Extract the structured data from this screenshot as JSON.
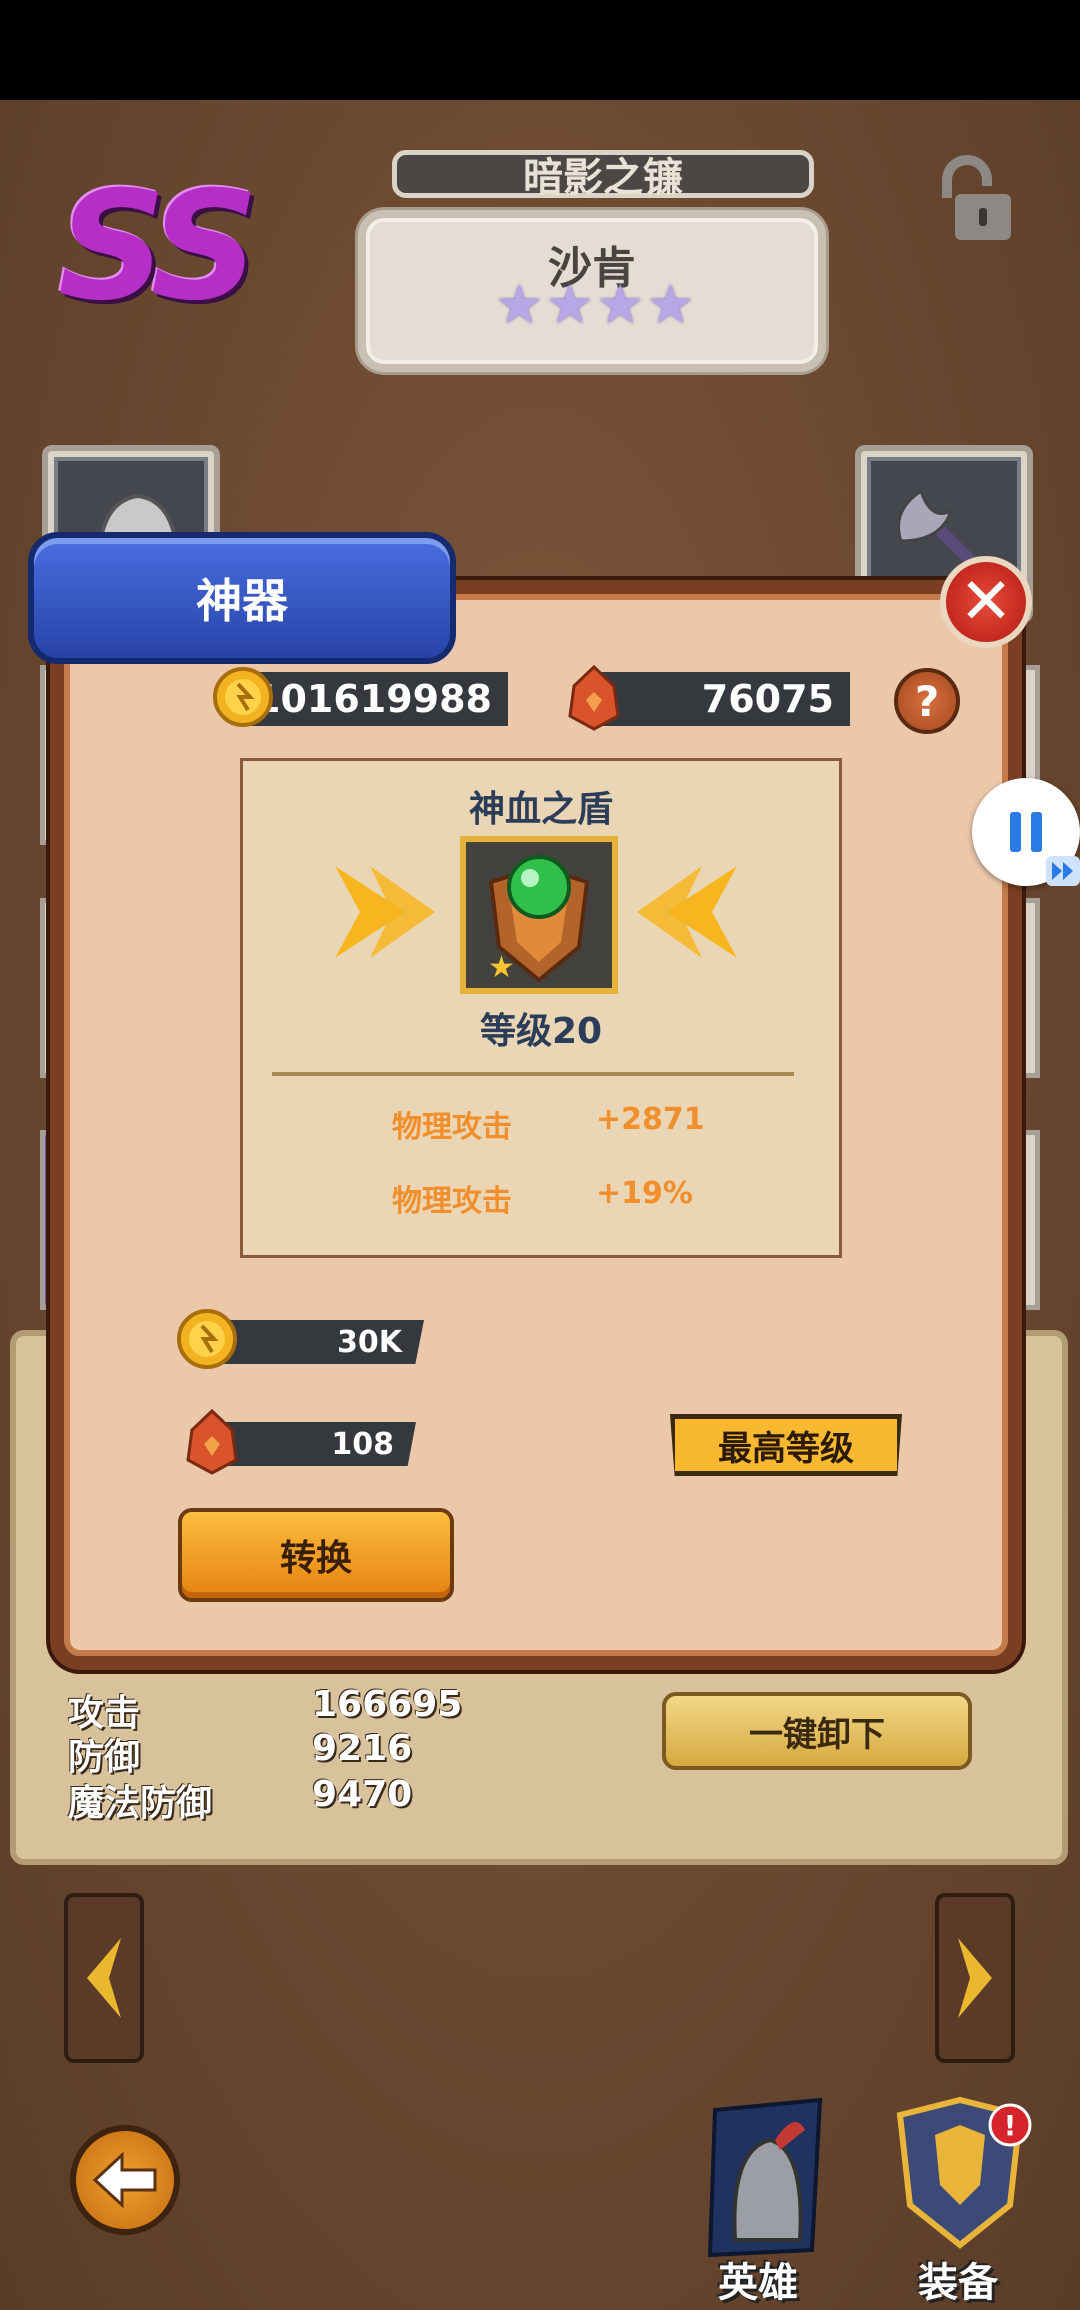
{
  "header": {
    "grade": "SS",
    "equipment_name": "暗影之镰",
    "hero_name": "沙肯",
    "hero_stars": 4
  },
  "stats": [
    {
      "label": "攻击",
      "value": "166695"
    },
    {
      "label": "防御",
      "value": "9216"
    },
    {
      "label": "魔法防御",
      "value": "9470"
    }
  ],
  "unequip_all_label": "一键卸下",
  "modal": {
    "title": "神器",
    "close_icon": "close-icon",
    "gold_amount": "101619988",
    "ore_amount": "76075",
    "help_label": "?",
    "item_name": "神血之盾",
    "item_level": "等级20",
    "attributes": [
      {
        "label": "物理攻击",
        "value": "+2871"
      },
      {
        "label": "物理攻击",
        "value": "+19%"
      }
    ],
    "cost_gold": "30K",
    "cost_ore": "108",
    "max_level_label": "最高等级",
    "convert_label": "转换"
  },
  "bottom_tabs": [
    {
      "label": "英雄",
      "icon": "helmet-icon"
    },
    {
      "label": "装备",
      "icon": "armor-icon"
    }
  ],
  "colors": {
    "grade": "#b52fc7",
    "modal_header": "#2f4fb8",
    "attribute_text": "#f08f2c",
    "max_level": "#f8b830",
    "convert_button": "#f0a020"
  }
}
